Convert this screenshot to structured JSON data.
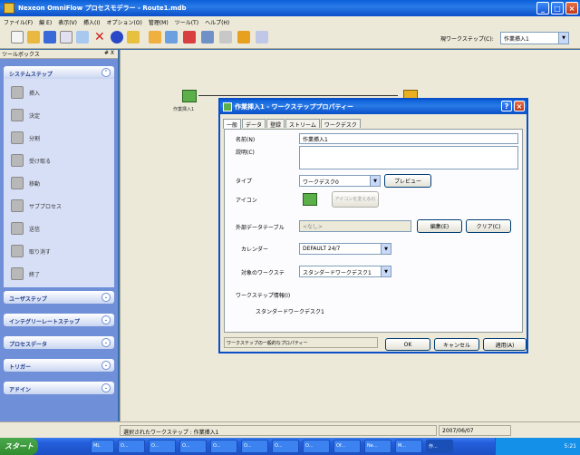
{
  "window": {
    "title": "Nexeon OmniFlow プロセスモデラー - Route1.mdb"
  },
  "menu": [
    "ファイル(F)",
    "編 E)",
    "表示(V)",
    "挿入(I)",
    "オプション(O)",
    "管理(M)",
    "ツール(T)",
    "ヘルプ(H)"
  ],
  "toolbar": {
    "current_step_label": "現ワークステップ(C):",
    "current_step_value": "作業挿入1"
  },
  "toolbox": {
    "title": "ツールボックス",
    "pin": "# X",
    "system_steps_title": "システムステップ",
    "items": [
      "挿入",
      "決定",
      "分割",
      "受け取る",
      "移動",
      "サブプロセス",
      "送信",
      "取り消す",
      "終了"
    ],
    "collapsed_sections": [
      "ユーザステップ",
      "インテグリーレートステップ",
      "プロセスデータ",
      "トリガー",
      "アドイン"
    ]
  },
  "canvas": {
    "node_label": "作業挿入1"
  },
  "dialog": {
    "title": "作業挿入1 - ワークステッププロパティー",
    "tabs": [
      "一般",
      "データ",
      "登録",
      "ストリーム",
      "ワークデスク"
    ],
    "name_label": "名前(N)",
    "name_value": "作業挿入1",
    "desc_label": "説明(C)",
    "type_label": "タイプ",
    "type_value": "ワークデスク0",
    "preview_button": "プレビュー",
    "icon_label": "アイコン",
    "icon_button": "アイコンを変える(I)",
    "external_table_label": "外部データテーブル",
    "external_table_value": "<なし>",
    "edit_button": "編集(E)",
    "clear_button": "クリア(C)",
    "calendar_label": "カレンダー",
    "calendar_value": "DEFAULT 24/7",
    "target_label": "対象のワークステ",
    "target_value": "スタンダードワークデスク1",
    "info_label": "ワークステップ情報(I)",
    "info_value": "スタンダードワークデスク1",
    "status_text": "ワークステップの一般的なプロパティー",
    "ok_button": "OK",
    "cancel_button": "キャンセル",
    "apply_button": "適用(A)"
  },
  "statusbar": {
    "selected": "選択されたワークステップ : 作業挿入1",
    "date": "2007/06/07"
  },
  "taskbar": {
    "start": "スタート",
    "tasks": [
      "ML",
      "O...",
      "O...",
      "O...",
      "O...",
      "O...",
      "O...",
      "O...",
      "Of...",
      "Ne...",
      "M...",
      "作..."
    ],
    "clock": "5:21"
  },
  "colors": {
    "xp_blue": "#0a5fd8",
    "toolbox_blue": "#6f8fd8",
    "canvas": "#ece9d8"
  }
}
